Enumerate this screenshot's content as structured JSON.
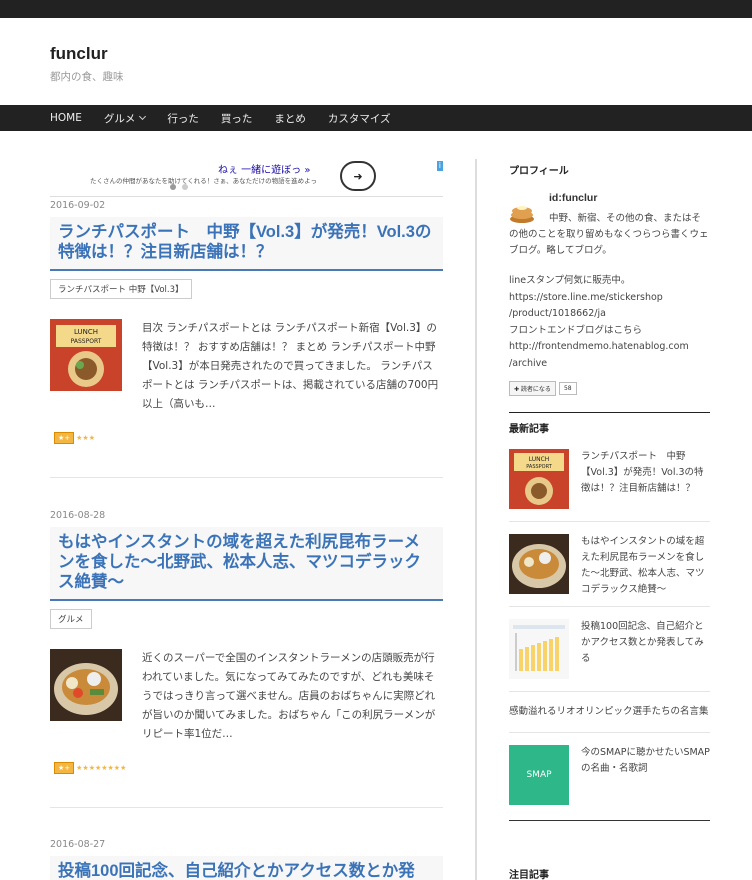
{
  "site": {
    "title": "funclur",
    "description": "都内の食、趣味"
  },
  "nav": {
    "items": [
      "HOME",
      "グルメ",
      "行った",
      "買った",
      "まとめ",
      "カスタマイズ"
    ]
  },
  "ad": {
    "line1": "ねぇ 一緒に遊ぼっ »",
    "line2": "たくさんの仲間があなたを助けてくれる！さぁ、あなただけの物語を進めよっ",
    "next_icon": "arrow-right-icon",
    "badge": "i"
  },
  "articles": [
    {
      "date": "2016-09-02",
      "title": "ランチパスポート　中野【Vol.3】が発売！Vol.3の特徴は！？注目新店舗は！？",
      "category": "ランチパスポート 中野【Vol.3】",
      "excerpt": "目次 ランチパスポートとは ランチパスポート新宿【Vol.3】の特徴は！？ おすすめ店舗は！？ まとめ ランチパスポート中野【Vol.3】が本日発売されたので買ってきました。 ランチパスポートとは ランチパスポートは、掲載されている店舗の700円以上（高いも…",
      "star_badge": "★+",
      "stars": "★★★"
    },
    {
      "date": "2016-08-28",
      "title": "もはやインスタントの域を超えた利尻昆布ラーメンを食した～北野武、松本人志、マツコデラックス絶賛～",
      "category": "グルメ",
      "excerpt": "近くのスーパーで全国のインスタントラーメンの店頭販売が行われていました。気になってみてみたのですが、どれも美味そうではっきり言って選べません。店員のおばちゃんに実際どれが旨いのか聞いてみました。おばちゃん「この利尻ラーメンがリピート率1位だ…",
      "star_badge": "★+",
      "stars": "★★★★★★★★"
    },
    {
      "date": "2016-08-27",
      "title": "投稿100回記念、自己紹介とかアクセス数とか発"
    }
  ],
  "sidebar": {
    "profile_heading": "プロフィール",
    "profile_name": "id:funclur",
    "profile_desc1": "中野、新宿、その他の食、またはそ",
    "profile_desc2": "の他のことを取り留めもなくつらつら書くウェブログ。略してブログ。",
    "bio_lines": [
      "lineスタンプ何気に販売中。",
      "https://store.line.me/stickershop",
      "/product/1018662/ja",
      "フロントエンドブログはこちら",
      "http://frontendmemo.hatenablog.com",
      "/archive"
    ],
    "readers_label": "✚ 読者になる",
    "readers_count": "58",
    "recent_heading": "最新記事",
    "recent": [
      {
        "title": "ランチパスポート　中野【Vol.3】が発売！Vol.3の特徴は！？注目新店舗は！？"
      },
      {
        "title": "もはやインスタントの域を超えた利尻昆布ラーメンを食した～北野武、松本人志、マツコデラックス絶賛～"
      },
      {
        "title": "投稿100回記念、自己紹介とかアクセス数とか発表してみる"
      },
      {
        "title": "感動溢れるリオオリンピック選手たちの名言集"
      },
      {
        "title": "今のSMAPに聴かせたいSMAPの名曲・名歌詞",
        "thumb_label": "SMAP"
      }
    ],
    "featured_heading": "注目記事"
  }
}
